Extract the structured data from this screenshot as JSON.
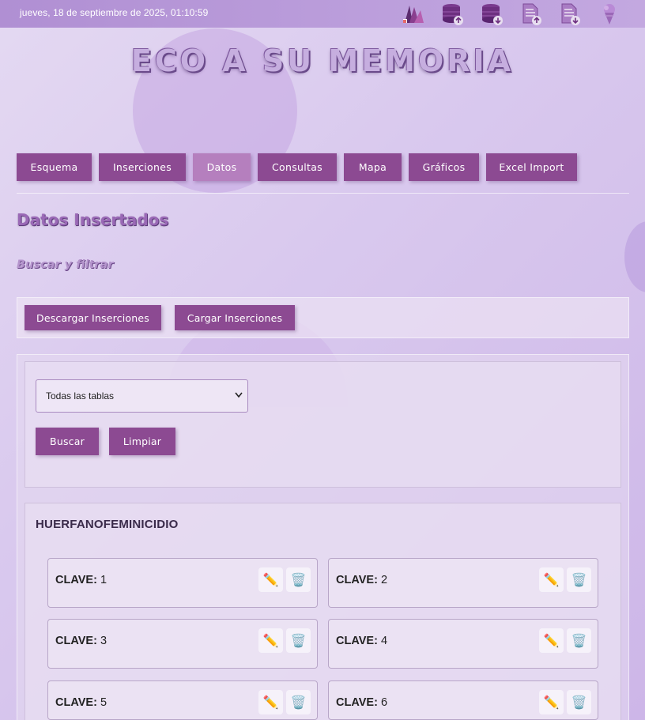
{
  "topbar": {
    "datetime": "jueves, 18 de septiembre de 2025, 01:10:59",
    "icons": [
      "palette-icon",
      "database-upload-icon",
      "database-download-icon",
      "document-upload-icon",
      "document-download-icon",
      "ice-cream-icon"
    ]
  },
  "header": {
    "title": "ECO A SU MEMORIA"
  },
  "nav": {
    "items": [
      {
        "label": "Esquema"
      },
      {
        "label": "Inserciones"
      },
      {
        "label": "Datos",
        "active": true
      },
      {
        "label": "Consultas"
      },
      {
        "label": "Mapa"
      },
      {
        "label": "Gráficos"
      },
      {
        "label": "Excel Import"
      }
    ]
  },
  "main": {
    "heading": "Datos Insertados",
    "subheading": "Buscar y filtrar",
    "download_label": "Descargar Inserciones",
    "upload_label": "Cargar Inserciones",
    "filter": {
      "selected_table": "Todas las tablas",
      "search_label": "Buscar",
      "clear_label": "Limpiar"
    },
    "table": {
      "name": "HUERFANOFEMINICIDIO",
      "key_label": "CLAVE:",
      "records": [
        {
          "value": "1"
        },
        {
          "value": "2"
        },
        {
          "value": "3"
        },
        {
          "value": "4"
        },
        {
          "value": "5"
        },
        {
          "value": "6"
        }
      ]
    }
  },
  "colors": {
    "accent": "#8c4a92",
    "active_tab": "#b57fbe",
    "background": "#d9c9ee"
  }
}
